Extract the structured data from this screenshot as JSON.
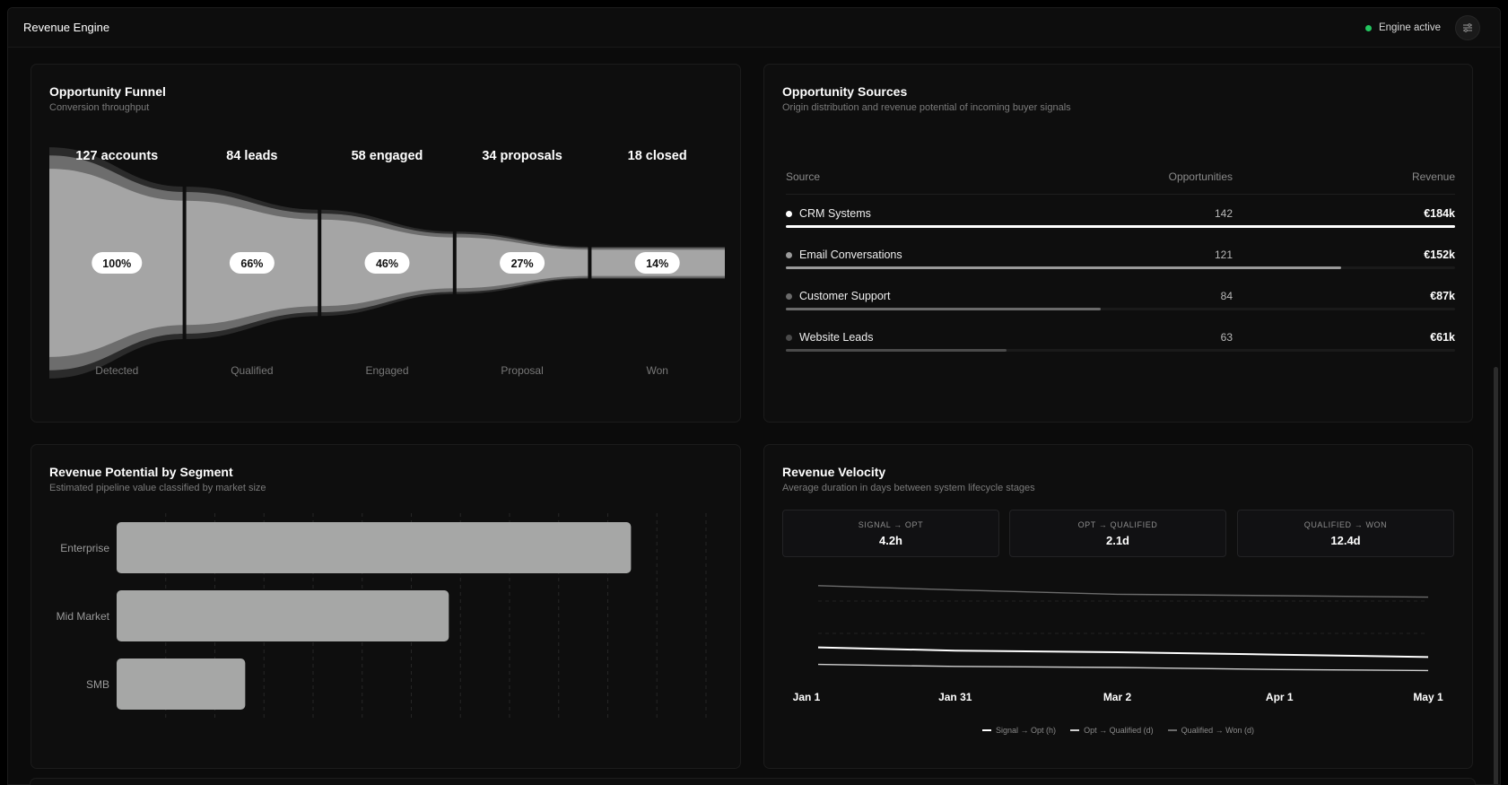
{
  "app": {
    "title": "Revenue Engine",
    "status_label": "Engine active",
    "status_color": "#22c55e",
    "menu_icon": "sliders-icon"
  },
  "funnel": {
    "title": "Opportunity Funnel",
    "subtitle": "Conversion throughput",
    "stages": [
      {
        "count_label": "127 accounts",
        "percent": "100%",
        "name": "Detected"
      },
      {
        "count_label": "84 leads",
        "percent": "66%",
        "name": "Qualified"
      },
      {
        "count_label": "58 engaged",
        "percent": "46%",
        "name": "Engaged"
      },
      {
        "count_label": "34 proposals",
        "percent": "27%",
        "name": "Proposal"
      },
      {
        "count_label": "18 closed",
        "percent": "14%",
        "name": "Won"
      }
    ]
  },
  "sources": {
    "title": "Opportunity Sources",
    "subtitle": "Origin distribution and revenue potential of incoming buyer signals",
    "headers": {
      "source": "Source",
      "opportunities": "Opportunities",
      "revenue": "Revenue"
    },
    "rows": [
      {
        "name": "CRM Systems",
        "opportunities": "142",
        "revenue": "€184k",
        "share": 1.0,
        "color": "#ffffff"
      },
      {
        "name": "Email Conversations",
        "opportunities": "121",
        "revenue": "€152k",
        "share": 0.83,
        "color": "#9a9a9a"
      },
      {
        "name": "Customer Support",
        "opportunities": "84",
        "revenue": "€87k",
        "share": 0.47,
        "color": "#6a6a6a"
      },
      {
        "name": "Website Leads",
        "opportunities": "63",
        "revenue": "€61k",
        "share": 0.33,
        "color": "#4a4a4a"
      }
    ]
  },
  "segments": {
    "title": "Revenue Potential by Segment",
    "subtitle": "Estimated pipeline value classified by market size",
    "chart_data": {
      "type": "bar",
      "orientation": "horizontal",
      "categories": [
        "Enterprise",
        "Mid Market",
        "SMB"
      ],
      "values": [
        96,
        62,
        24
      ],
      "xlim": [
        0,
        110
      ],
      "grid": true,
      "bar_color": "#a6a7a6"
    }
  },
  "velocity": {
    "title": "Revenue Velocity",
    "subtitle": "Average duration in days between system lifecycle stages",
    "stats": [
      {
        "label": "SIGNAL → OPT",
        "value": "4.2h"
      },
      {
        "label": "OPT → QUALIFIED",
        "value": "2.1d"
      },
      {
        "label": "QUALIFIED → WON",
        "value": "12.4d"
      }
    ],
    "chart_data": {
      "type": "line",
      "x": [
        "Jan 1",
        "Jan 31",
        "Mar 2",
        "Apr 1",
        "May 1"
      ],
      "series": [
        {
          "name": "Signal → Opt (h)",
          "values": [
            4.6,
            4.4,
            4.3,
            4.15,
            4.0
          ],
          "color": "#ffffff"
        },
        {
          "name": "Opt → Qualified (d)",
          "values": [
            2.4,
            2.3,
            2.25,
            2.15,
            2.1
          ],
          "color": "#d0d0d0"
        },
        {
          "name": "Qualified → Won (d)",
          "values": [
            13.2,
            12.9,
            12.6,
            12.5,
            12.4
          ],
          "color": "#6b6b6b"
        }
      ],
      "grid": true,
      "legend": "bottom"
    }
  }
}
